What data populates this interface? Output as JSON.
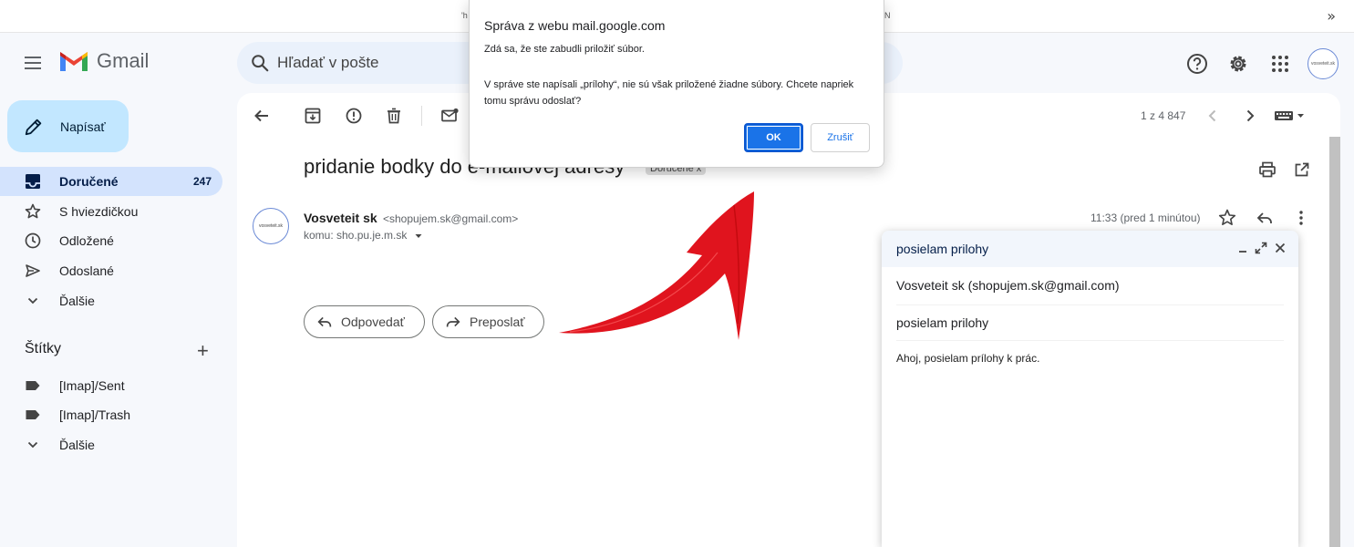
{
  "browser": {
    "overflow_icon": "»",
    "fragment_left": "'h",
    "fragment_right": "N"
  },
  "header": {
    "app_name": "Gmail",
    "search_placeholder": "Hľadať v pošte",
    "avatar_label": "vosveteit.sk"
  },
  "sidebar": {
    "compose_label": "Napísať",
    "items": [
      {
        "label": "Doručené",
        "count": "247",
        "icon": "inbox-icon"
      },
      {
        "label": "S hviezdičkou",
        "icon": "star-icon"
      },
      {
        "label": "Odložené",
        "icon": "clock-icon"
      },
      {
        "label": "Odoslané",
        "icon": "send-icon"
      },
      {
        "label": "Ďalšie",
        "icon": "chevron-down-icon"
      }
    ],
    "labels_title": "Štítky",
    "labels_add": "+",
    "labels": [
      {
        "label": "[Imap]/Sent",
        "icon": "label-icon"
      },
      {
        "label": "[Imap]/Trash",
        "icon": "label-icon"
      },
      {
        "label": "Ďalšie",
        "icon": "chevron-down-icon"
      }
    ]
  },
  "message": {
    "pager": "1 z 4 847",
    "subject": "pridanie bodky do e-mailovej adresy",
    "tag": "Doručené",
    "tag_close": "x",
    "sender_name": "Vosveteit sk",
    "sender_email": "<shopujem.sk@gmail.com>",
    "recipient": "komu: sho.pu.je.m.sk",
    "time": "11:33 (pred 1 minútou)",
    "sender_avatar_label": "vosveteit.sk",
    "reply_label": "Odpovedať",
    "forward_label": "Preposlať"
  },
  "compose_window": {
    "title": "posielam prilohy",
    "from": "Vosveteit sk (shopujem.sk@gmail.com)",
    "subject": "posielam prilohy",
    "body": "Ahoj, posielam prílohy k prác."
  },
  "dialog": {
    "title": "Správa z webu mail.google.com",
    "line1": "Zdá sa, že ste zabudli priložiť súbor.",
    "line2": "V správe ste napísali „prílohy“, nie sú však priložené žiadne súbory. Chcete napriek tomu správu odoslať?",
    "ok_label": "OK",
    "cancel_label": "Zrušiť"
  },
  "colors": {
    "accent": "#1a73e8",
    "active_nav": "#d3e3fd",
    "compose_bg": "#c2e7ff",
    "arrow": "#e0141e"
  }
}
